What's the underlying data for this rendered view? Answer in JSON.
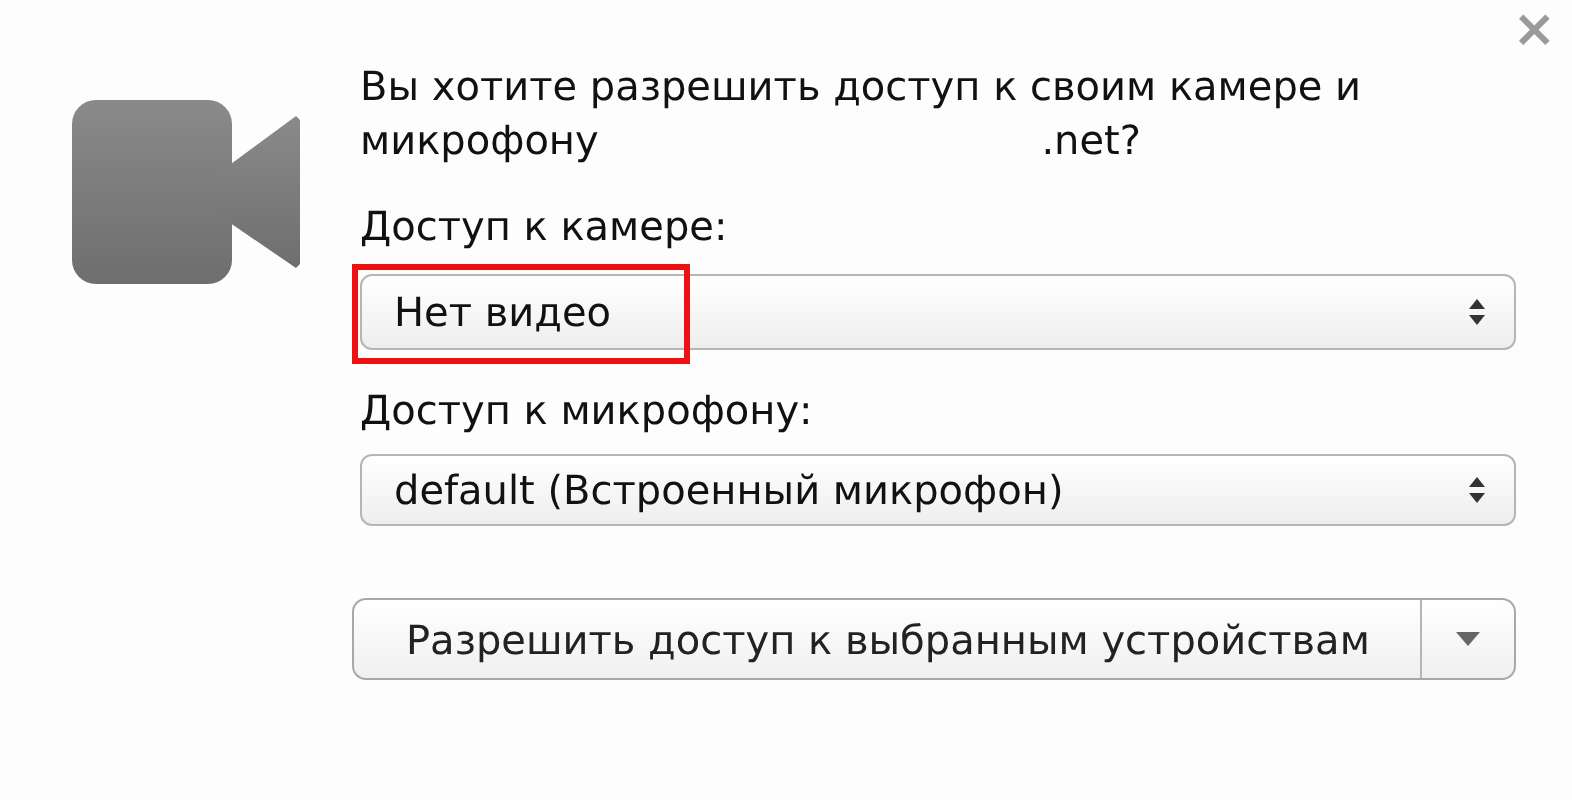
{
  "dialog": {
    "close": "×",
    "message": "Вы хотите разрешить доступ к своим камере и микрофону",
    "domain": ".net?",
    "fields": [
      {
        "label": "Доступ к камере:",
        "value": "Нет видео",
        "highlighted": true
      },
      {
        "label": "Доступ к микрофону:",
        "value": "default (Встроенный микрофон)",
        "highlighted": false
      }
    ],
    "button": "Разрешить доступ к выбранным устройствам"
  }
}
